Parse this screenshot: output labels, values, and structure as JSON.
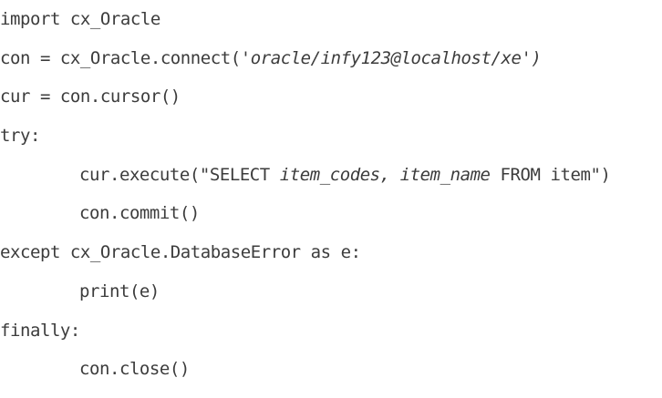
{
  "code": {
    "lines": [
      {
        "text": "import cx_Oracle"
      },
      {
        "prefix": "con = cx_Oracle.connect(",
        "italic": "'oracle/infy123@localhost/xe')"
      },
      {
        "text": "cur = con.cursor()"
      },
      {
        "text": "try:"
      },
      {
        "prefix": "cur.execute(\"SELECT ",
        "italic": "item_codes, item_name",
        "suffix": " FROM item\")"
      },
      {
        "text": "con.commit()"
      },
      {
        "text": "except cx_Oracle.DatabaseError as e:"
      },
      {
        "text": "print(e)"
      },
      {
        "text": "finally:"
      },
      {
        "text": "con.close()"
      }
    ]
  }
}
